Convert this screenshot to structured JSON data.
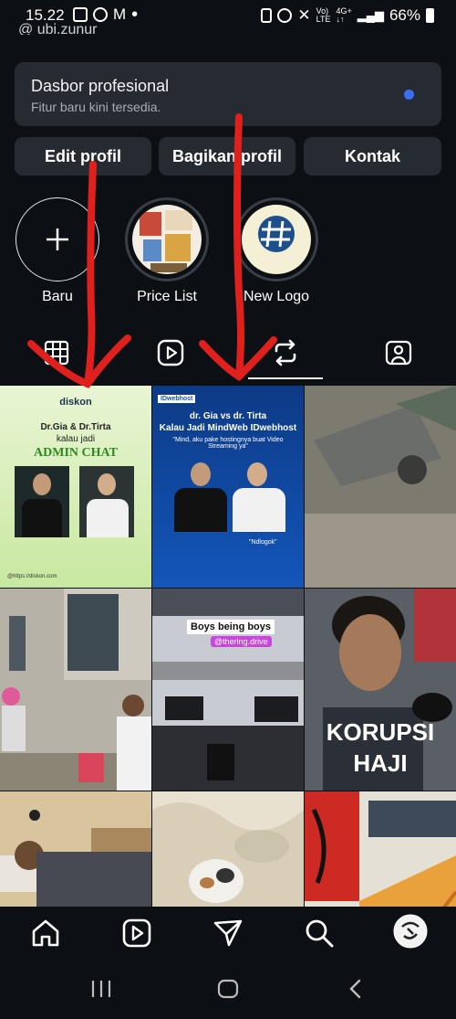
{
  "status_bar": {
    "time": "15.22",
    "battery": "66%"
  },
  "profile": {
    "username_partial": "ubi.zunur"
  },
  "dashboard": {
    "title": "Dasbor profesional",
    "subtitle": "Fitur baru kini tersedia.",
    "dot_color": "#3e6df5"
  },
  "actions": {
    "edit": "Edit profil",
    "share": "Bagikan profil",
    "contact": "Kontak"
  },
  "highlights": [
    {
      "label": "Baru"
    },
    {
      "label": "Price List"
    },
    {
      "label": "New Logo"
    }
  ],
  "posts": {
    "p1": {
      "brand": "diskon",
      "line1": "Dr.Gia & Dr.Tirta",
      "line2": "kalau jadi",
      "headline": "ADMIN CHAT",
      "footer": "@https://diskon.com"
    },
    "p2": {
      "brand": "IDwebhost",
      "title1": "dr. Gia vs dr. Tirta",
      "title2": "Kalau Jadi MindWeb IDwebhost",
      "quote": "\"Mind, aku pake hostingnya buat Video Streaming ya\"",
      "reply": "\"Ndlogok\""
    },
    "p5": {
      "label1": "Boys being boys",
      "label2": "@thering.drive"
    },
    "p6": {
      "headline1": "KORUPSI",
      "headline2": "HAJI"
    }
  },
  "colors": {
    "background": "#0c0f14",
    "card": "#262a31",
    "accent_arrow": "#e0201c"
  }
}
